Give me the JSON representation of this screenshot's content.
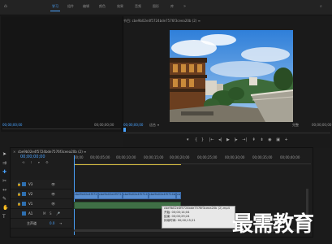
{
  "workspaces": [
    "学习",
    "组件",
    "编辑",
    "颜色",
    "效果",
    "音频",
    "图形",
    "库"
  ],
  "active_workspace_index": 0,
  "program_monitor": {
    "title": "节目: cbe9b02e4f5724bde7576f3ceea20b (2) ≡",
    "timecode_left": "00;00;00;00",
    "fit_label": "适合",
    "quality_label": "完整",
    "timecode_right": "00;00;00;00"
  },
  "source_monitor": {
    "timecode_left": "00;00;00;00",
    "timecode_right": "00;00;00;00"
  },
  "timeline": {
    "sequence_name": "cbe9b02e4f5724bde7576f3ceea20b (2) ≡",
    "timecode": "00;00;00;00",
    "ruler_ticks": [
      "00;00",
      "00;00;05;00",
      "00;00;10;00",
      "00;00;15;00",
      "00;00;20;00",
      "00;00;25;00",
      "00;00;30;00",
      "00;00;35;00",
      "00;00;40;00"
    ],
    "tracks": [
      "V3",
      "V2",
      "V1",
      "A1",
      "A2",
      "A3"
    ],
    "master_label": "主声道",
    "master_value": "0.0",
    "clips": [
      "cbe9b02e4f5724bde...",
      "cbe9b02e4f5724bde...",
      "cbe9b02e4f5724bde...",
      "cbe9b02e4f5724bde...",
      "cbe9b02e4f5724bde..."
    ]
  },
  "tooltip": {
    "line1": "cbe9b02e4f5724bde7576f3ceea20b (2).mp4",
    "line2": "开始: 00;00;14;04",
    "line3": "结束: 00;00;29;24",
    "line4": "持续时间: 00;00;15;21"
  },
  "watermark": "最需教育",
  "colors": {
    "accent": "#4aa3ff",
    "clip": "#5b8fd0",
    "track_button": "#2e6fb0"
  }
}
